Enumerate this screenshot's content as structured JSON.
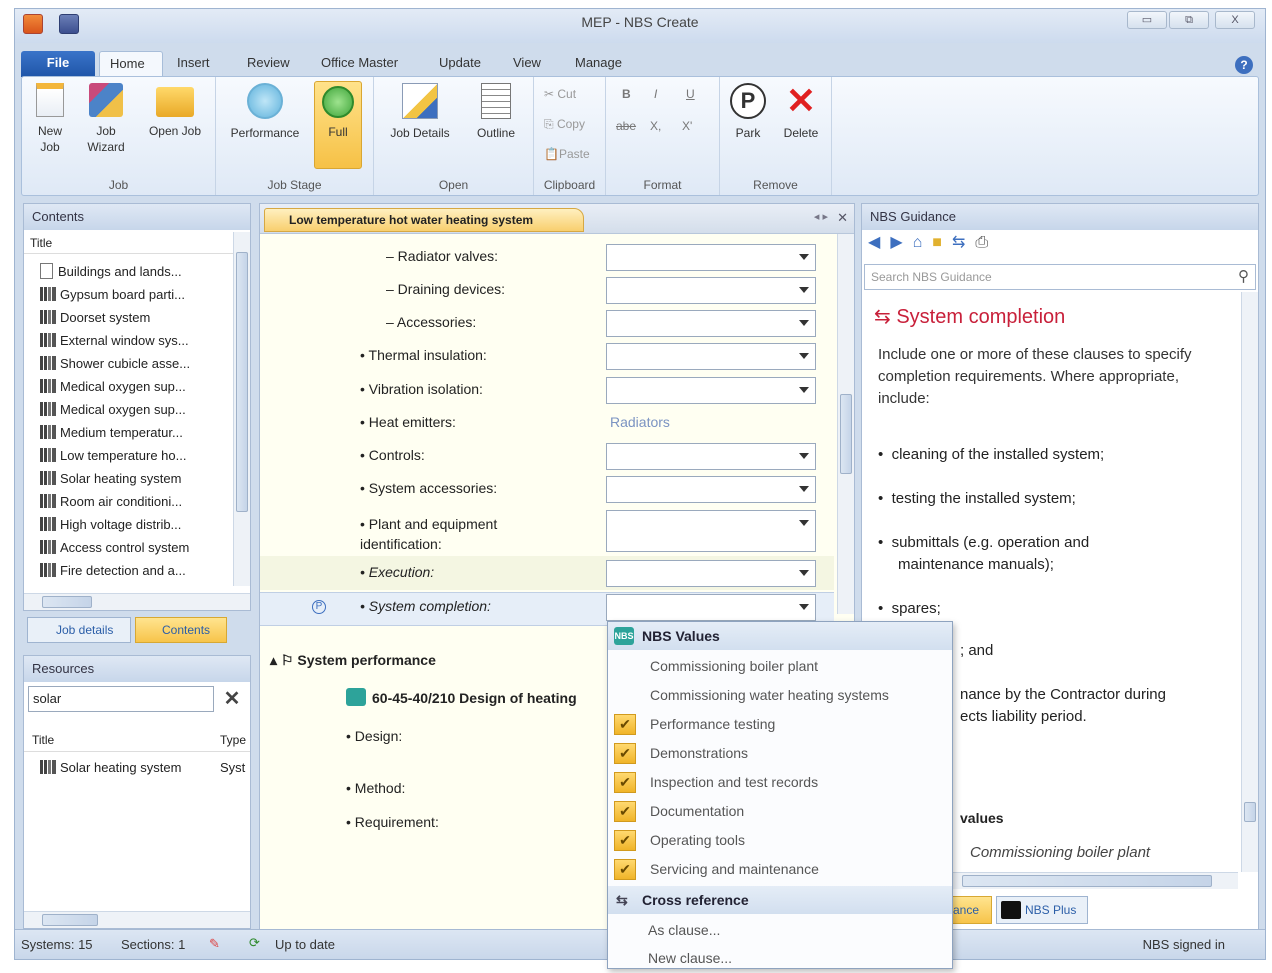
{
  "window": {
    "title": "MEP - NBS Create",
    "min": "▭",
    "max": "⧉",
    "close": "X"
  },
  "tabs": [
    {
      "label": "File"
    },
    {
      "label": "Home"
    },
    {
      "label": "Insert"
    },
    {
      "label": "Review"
    },
    {
      "label": "Office Master"
    },
    {
      "label": "Update"
    },
    {
      "label": "View"
    },
    {
      "label": "Manage"
    }
  ],
  "ribbon": {
    "job": {
      "label": "Job",
      "new_job": "New Job",
      "job_wizard": "Job Wizard",
      "open_job": "Open Job"
    },
    "job_stage": {
      "label": "Job Stage",
      "performance": "Performance",
      "full": "Full"
    },
    "open": {
      "label": "Open",
      "job_details": "Job Details",
      "outline": "Outline"
    },
    "clipboard": {
      "label": "Clipboard",
      "cut": "Cut",
      "copy": "Copy",
      "paste": "Paste"
    },
    "format": {
      "label": "Format",
      "bold": "B",
      "italic": "I",
      "underline": "U",
      "strike": "abe",
      "sub": "X,",
      "sup": "X'"
    },
    "remove": {
      "label": "Remove",
      "park": "Park",
      "delete": "Delete"
    }
  },
  "contents": {
    "title": "Contents",
    "column": "Title",
    "items": [
      "Buildings and lands...",
      "Gypsum board parti...",
      "Doorset system",
      "External window sys...",
      "Shower cubicle asse...",
      "Medical oxygen sup...",
      "Medical oxygen sup...",
      "Medium temperatur...",
      "Low temperature ho...",
      "Solar heating system",
      "Room air conditioni...",
      "High voltage distrib...",
      "Access control system",
      "Fire detection and a..."
    ],
    "tab_job_details": "Job details",
    "tab_contents": "Contents"
  },
  "resources": {
    "title": "Resources",
    "search_value": "solar",
    "col_title": "Title",
    "col_type": "Type",
    "items": [
      {
        "title": "Solar heating system",
        "type": "Syst"
      }
    ]
  },
  "editor": {
    "tab_title": "Low temperature hot water heating system",
    "fields": [
      {
        "label": "– Radiator valves:"
      },
      {
        "label": "– Draining devices:"
      },
      {
        "label": "– Accessories:"
      },
      {
        "label": "• Thermal insulation:"
      },
      {
        "label": "• Vibration isolation:"
      },
      {
        "label": "• Heat emitters:",
        "value": "Radiators"
      },
      {
        "label": "• Controls:"
      },
      {
        "label": "• System accessories:"
      },
      {
        "label": "• Plant and equipment identification:"
      },
      {
        "label": "• Execution:"
      },
      {
        "label": "• System completion:"
      }
    ],
    "section": "System performance",
    "clause": "60-45-40/210  Design of heating",
    "sub_fields": [
      "• Design:",
      "• Method:",
      "• Requirement:"
    ]
  },
  "menu": {
    "header": "NBS Values",
    "items": [
      {
        "label": "Commissioning boiler plant",
        "checked": false
      },
      {
        "label": "Commissioning water heating systems",
        "checked": false
      },
      {
        "label": "Performance testing",
        "checked": true
      },
      {
        "label": "Demonstrations",
        "checked": true
      },
      {
        "label": "Inspection and test records",
        "checked": true
      },
      {
        "label": "Documentation",
        "checked": true
      },
      {
        "label": "Operating tools",
        "checked": true
      },
      {
        "label": "Servicing and maintenance",
        "checked": true
      }
    ],
    "cross_ref": "Cross reference",
    "as_clause": "As clause...",
    "new_clause": "New clause..."
  },
  "guidance": {
    "title": "NBS Guidance",
    "search_placeholder": "Search NBS Guidance",
    "heading": "System completion",
    "intro": "Include one or more of these clauses to specify completion requirements. Where appropriate, include:",
    "bullets": [
      "cleaning of the installed system;",
      "testing the installed system;",
      "submittals (e.g. operation and maintenance manuals);",
      "spares;"
    ],
    "hidden_1": "; and",
    "hidden_2": "nance by the Contractor during",
    "hidden_3": "ects liability period.",
    "values_label": "values",
    "values_item": "Commissioning boiler plant",
    "tab_guidance": "ance",
    "tab_plus": "NBS Plus"
  },
  "status": {
    "systems": "Systems: 15",
    "sections": "Sections: 1",
    "up_to_date": "Up to date",
    "signed_in": "NBS signed in"
  }
}
